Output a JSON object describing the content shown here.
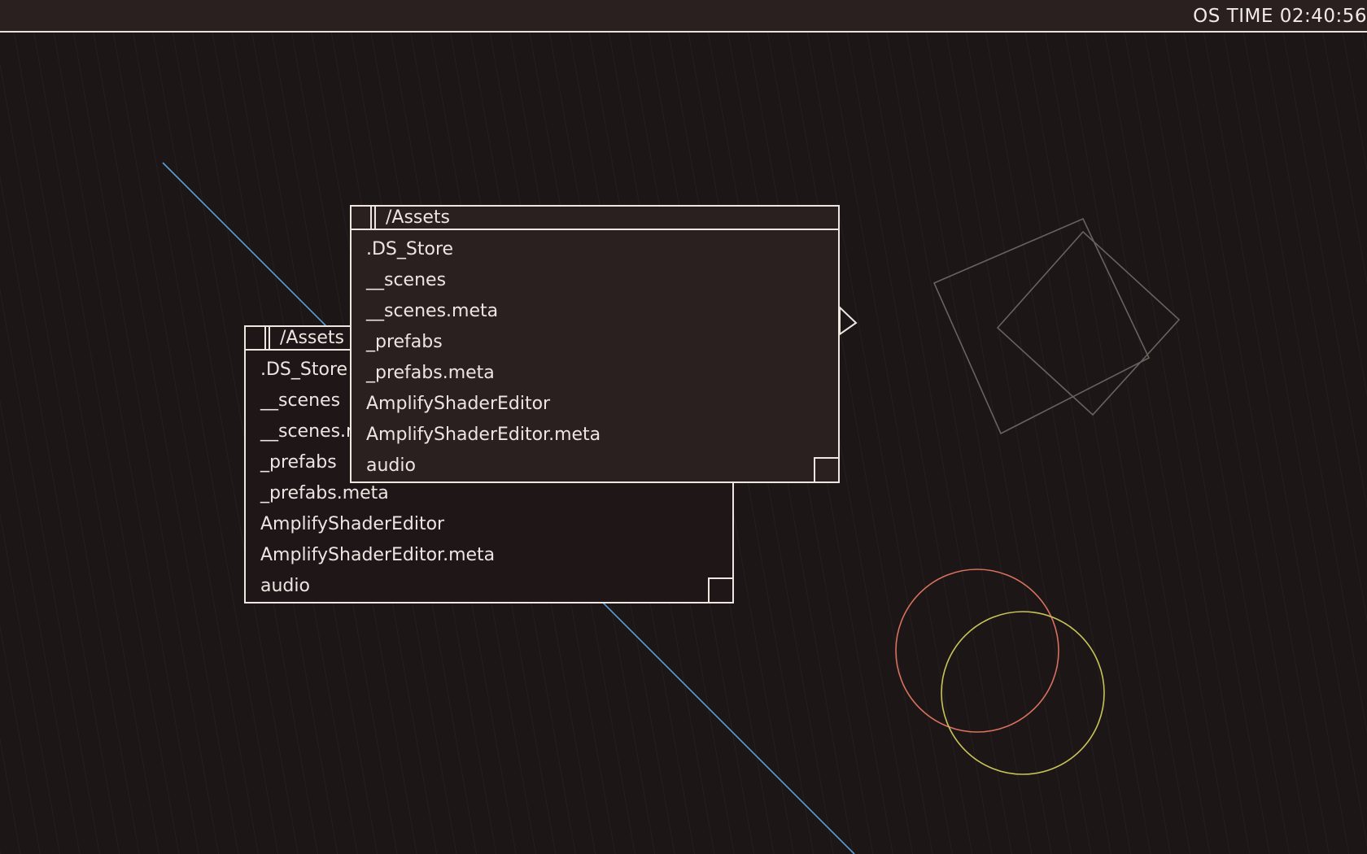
{
  "topbar": {
    "clock": "OS TIME 02:40:56"
  },
  "colors": {
    "background": "#1c1616",
    "window_back": "#1f1717",
    "window_front": "#2b2020",
    "foreground": "#ede6e1",
    "line_blue": "#5a9fd8",
    "circle_red": "#d97060",
    "circle_yellow": "#c9c45a",
    "square_grey": "#6a625e"
  },
  "windows": [
    {
      "title": "/Assets",
      "items": [
        ".DS_Store",
        "__scenes",
        "__scenes.meta",
        "_prefabs",
        "_prefabs.meta",
        "AmplifyShaderEditor",
        "AmplifyShaderEditor.meta",
        "audio"
      ]
    },
    {
      "title": "/Assets",
      "items": [
        ".DS_Store",
        "__scenes",
        "__scenes.meta",
        "_prefabs",
        "_prefabs.meta",
        "AmplifyShaderEditor",
        "AmplifyShaderEditor.meta",
        "audio"
      ]
    }
  ],
  "icons": {
    "close": "close-box-icon",
    "resize": "resize-handle-icon",
    "expand": "triangle-right-icon"
  }
}
